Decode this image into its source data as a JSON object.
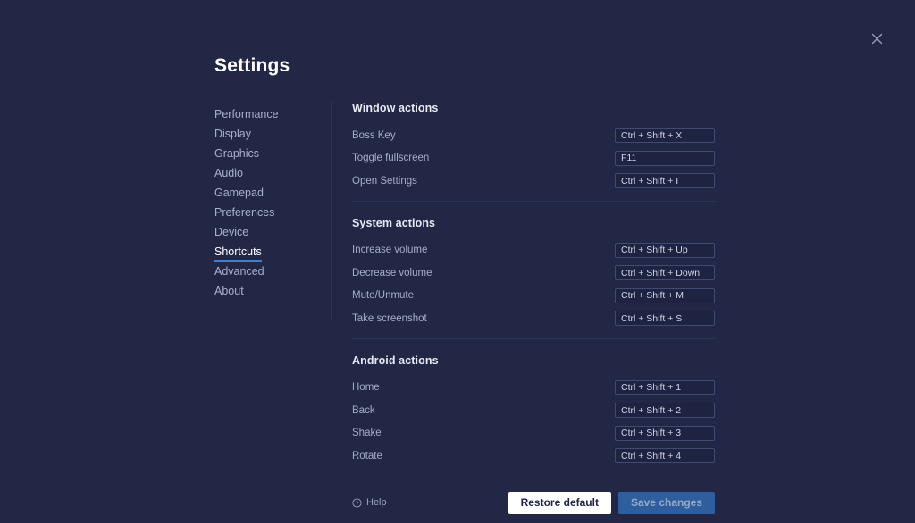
{
  "window": {
    "title": "Settings",
    "close_icon": "close-icon"
  },
  "sidebar": {
    "items": [
      {
        "label": "Performance",
        "active": false
      },
      {
        "label": "Display",
        "active": false
      },
      {
        "label": "Graphics",
        "active": false
      },
      {
        "label": "Audio",
        "active": false
      },
      {
        "label": "Gamepad",
        "active": false
      },
      {
        "label": "Preferences",
        "active": false
      },
      {
        "label": "Device",
        "active": false
      },
      {
        "label": "Shortcuts",
        "active": true
      },
      {
        "label": "Advanced",
        "active": false
      },
      {
        "label": "About",
        "active": false
      }
    ]
  },
  "sections": [
    {
      "title": "Window actions",
      "rows": [
        {
          "label": "Boss Key",
          "value": "Ctrl + Shift + X"
        },
        {
          "label": "Toggle fullscreen",
          "value": "F11"
        },
        {
          "label": "Open Settings",
          "value": "Ctrl + Shift + I"
        }
      ]
    },
    {
      "title": "System actions",
      "rows": [
        {
          "label": "Increase volume",
          "value": "Ctrl + Shift + Up"
        },
        {
          "label": "Decrease volume",
          "value": "Ctrl + Shift + Down"
        },
        {
          "label": "Mute/Unmute",
          "value": "Ctrl + Shift + M"
        },
        {
          "label": "Take screenshot",
          "value": "Ctrl + Shift + S"
        }
      ]
    },
    {
      "title": "Android actions",
      "rows": [
        {
          "label": "Home",
          "value": "Ctrl + Shift + 1"
        },
        {
          "label": "Back",
          "value": "Ctrl + Shift + 2"
        },
        {
          "label": "Shake",
          "value": "Ctrl + Shift + 3"
        },
        {
          "label": "Rotate",
          "value": "Ctrl + Shift + 4"
        }
      ]
    }
  ],
  "footer": {
    "help_label": "Help",
    "help_icon": "question-circle-icon",
    "restore_label": "Restore default",
    "save_label": "Save changes"
  },
  "colors": {
    "background": "#212745",
    "accent": "#3f7fd0",
    "primary_button": "#2e5e9e",
    "input_background": "#1d2340",
    "input_border": "#414a72",
    "divider": "#2c3356"
  }
}
